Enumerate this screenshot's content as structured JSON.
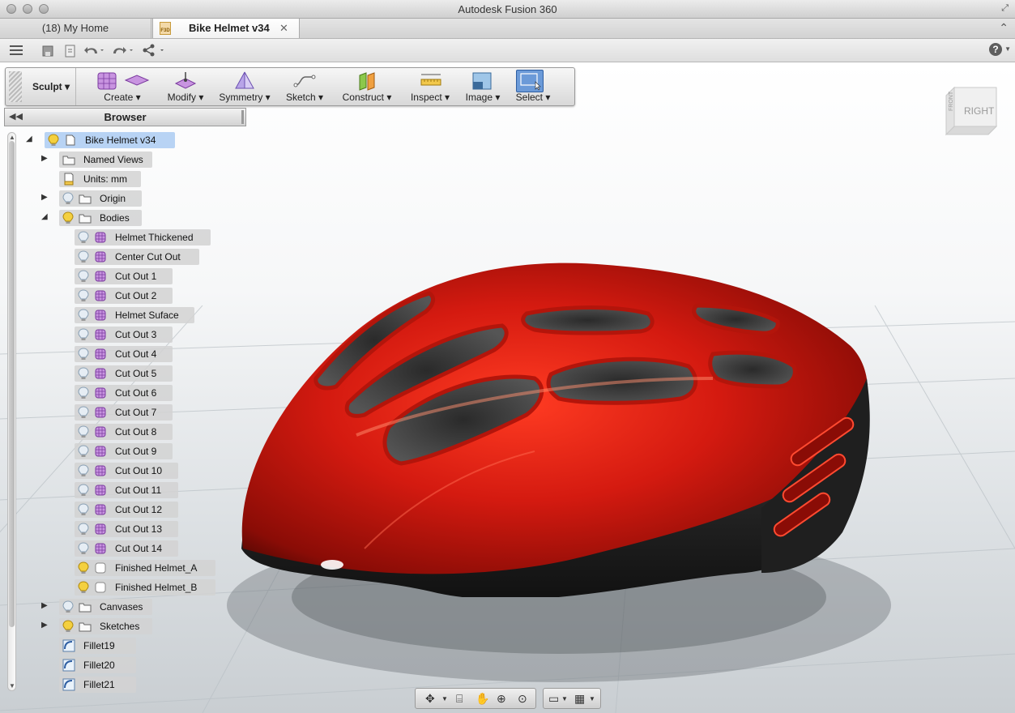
{
  "window": {
    "title": "Autodesk Fusion 360"
  },
  "tabs": [
    {
      "label": "(18) My Home",
      "active": false
    },
    {
      "label": "Bike Helmet v34",
      "active": true,
      "close": "✕",
      "file_badge": "F3D"
    }
  ],
  "ribbon": {
    "workspace": "Sculpt",
    "groups": [
      {
        "label": "Create"
      },
      {
        "label": "Modify"
      },
      {
        "label": "Symmetry"
      },
      {
        "label": "Sketch"
      },
      {
        "label": "Construct"
      },
      {
        "label": "Inspect"
      },
      {
        "label": "Image"
      },
      {
        "label": "Select"
      }
    ]
  },
  "browser": {
    "title": "Browser",
    "root": "Bike Helmet v34",
    "named_views": "Named Views",
    "units": "Units: mm",
    "origin": "Origin",
    "bodies": "Bodies",
    "body_items": [
      "Helmet Thickened",
      "Center Cut Out",
      "Cut Out 1",
      "Cut Out 2",
      "Helmet Suface",
      "Cut Out 3",
      "Cut Out 4",
      "Cut Out 5",
      "Cut Out 6",
      "Cut Out 7",
      "Cut Out 8",
      "Cut Out 9",
      "Cut Out 10",
      "Cut Out 11",
      "Cut Out 12",
      "Cut Out 13",
      "Cut Out 14",
      "Finished Helmet_A",
      "Finished Helmet_B"
    ],
    "canvases": "Canvases",
    "sketches": "Sketches",
    "features": [
      "Fillet19",
      "Fillet20",
      "Fillet21"
    ]
  },
  "viewcube": {
    "front": "FRONT",
    "right": "RIGHT"
  },
  "colors": {
    "helmet": "#d41a10",
    "helmet_dark": "#1c1c1c",
    "select_active": "#6b9ad8",
    "highlight": "#b8d3f4"
  }
}
